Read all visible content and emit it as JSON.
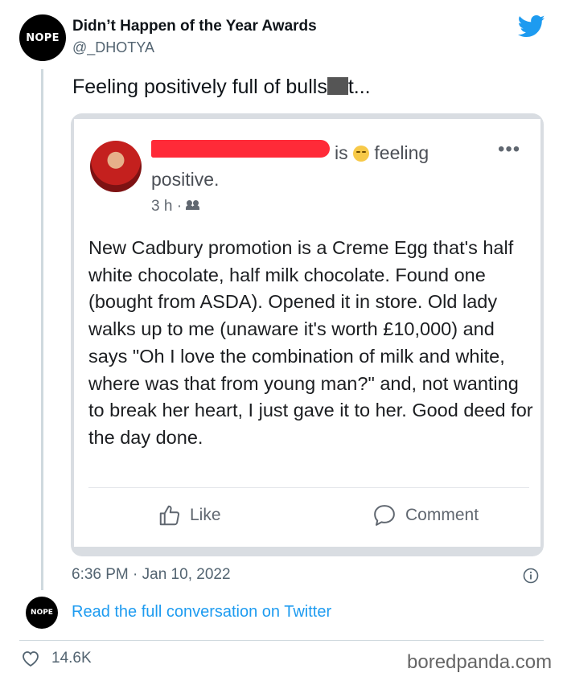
{
  "tweet": {
    "avatar_label": "NOPE",
    "display_name": "Didn’t Happen of the Year Awards",
    "handle": "@_DHOTYA",
    "text_before": "Feeling positively full of bulls",
    "text_after": "t...",
    "timestamp": "6:36 PM · Jan 10, 2022",
    "read_conversation": "Read the full conversation on Twitter",
    "like_count": "14.6K",
    "accent_color": "#1d9bf0"
  },
  "fb_post": {
    "status_is": "is",
    "status_feeling": "feeling",
    "status_feeling_word": "positive.",
    "time": "3 h ·",
    "body": "New Cadbury promotion is a Creme Egg that's half white chocolate, half milk chocolate. Found one (bought from ASDA). Opened it in store. Old lady walks up to me (unaware it's worth £10,000) and says \"Oh I love the combination of milk and white, where was that from young man?\" and, not wanting to break her heart, I just gave it to her. Good deed for the day done.",
    "like_label": "Like",
    "comment_label": "Comment",
    "more_icon": "•••"
  },
  "watermark": "boredpanda.com"
}
